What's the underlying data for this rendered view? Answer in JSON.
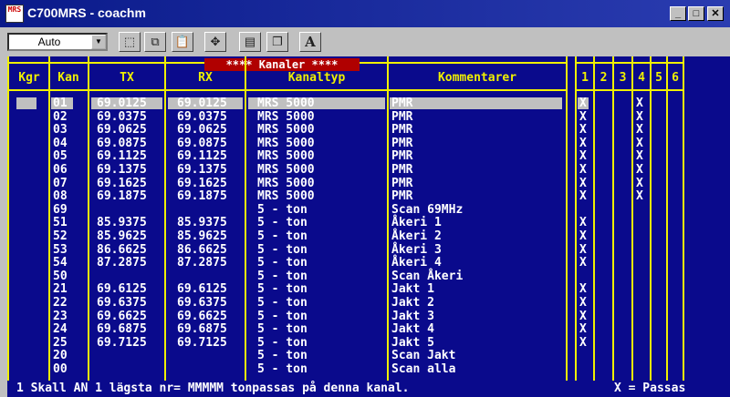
{
  "window": {
    "title": "C700MRS - coachm",
    "icon_text": "MRS",
    "minimize": "_",
    "maximize": "□",
    "close": "✕"
  },
  "toolbar": {
    "zoom_value": "Auto",
    "combo_arrow": "▼",
    "buttons": [
      {
        "name": "select-icon",
        "glyph": "⬚"
      },
      {
        "name": "copy-icon",
        "glyph": "⧉"
      },
      {
        "name": "paste-icon",
        "glyph": "📋"
      },
      {
        "name": "fullscreen-icon",
        "glyph": "✥"
      },
      {
        "name": "properties-icon",
        "glyph": "▤"
      },
      {
        "name": "background-icon",
        "glyph": "❐"
      },
      {
        "name": "font-icon",
        "glyph": "A"
      }
    ]
  },
  "banner": "**** Kanaler ****",
  "headers": {
    "kgr": "Kgr",
    "kan": "Kan",
    "tx": "TX",
    "rx": "RX",
    "kanaltyp": "Kanaltyp",
    "kommentarer": "Kommentarer",
    "c1": "1",
    "c2": "2",
    "c3": "3",
    "c4": "4",
    "c5": "5",
    "c6": "6"
  },
  "rows": [
    {
      "kan": "01",
      "tx": "69.0125",
      "rx": "69.0125",
      "typ": "MRS 5000",
      "kom": "PMR",
      "c1": "X",
      "c4": "X"
    },
    {
      "kan": "02",
      "tx": "69.0375",
      "rx": "69.0375",
      "typ": "MRS 5000",
      "kom": "PMR",
      "c1": "X",
      "c4": "X"
    },
    {
      "kan": "03",
      "tx": "69.0625",
      "rx": "69.0625",
      "typ": "MRS 5000",
      "kom": "PMR",
      "c1": "X",
      "c4": "X"
    },
    {
      "kan": "04",
      "tx": "69.0875",
      "rx": "69.0875",
      "typ": "MRS 5000",
      "kom": "PMR",
      "c1": "X",
      "c4": "X"
    },
    {
      "kan": "05",
      "tx": "69.1125",
      "rx": "69.1125",
      "typ": "MRS 5000",
      "kom": "PMR",
      "c1": "X",
      "c4": "X"
    },
    {
      "kan": "06",
      "tx": "69.1375",
      "rx": "69.1375",
      "typ": "MRS 5000",
      "kom": "PMR",
      "c1": "X",
      "c4": "X"
    },
    {
      "kan": "07",
      "tx": "69.1625",
      "rx": "69.1625",
      "typ": "MRS 5000",
      "kom": "PMR",
      "c1": "X",
      "c4": "X"
    },
    {
      "kan": "08",
      "tx": "69.1875",
      "rx": "69.1875",
      "typ": "MRS 5000",
      "kom": "PMR",
      "c1": "X",
      "c4": "X"
    },
    {
      "kan": "69",
      "tx": "",
      "rx": "",
      "typ": "5 - ton",
      "kom": "Scan 69MHz",
      "c1": "",
      "c4": ""
    },
    {
      "kan": "51",
      "tx": "85.9375",
      "rx": "85.9375",
      "typ": "5 - ton",
      "kom": "Åkeri 1",
      "c1": "X",
      "c4": ""
    },
    {
      "kan": "52",
      "tx": "85.9625",
      "rx": "85.9625",
      "typ": "5 - ton",
      "kom": "Åkeri 2",
      "c1": "X",
      "c4": ""
    },
    {
      "kan": "53",
      "tx": "86.6625",
      "rx": "86.6625",
      "typ": "5 - ton",
      "kom": "Åkeri 3",
      "c1": "X",
      "c4": ""
    },
    {
      "kan": "54",
      "tx": "87.2875",
      "rx": "87.2875",
      "typ": "5 - ton",
      "kom": "Åkeri 4",
      "c1": "X",
      "c4": ""
    },
    {
      "kan": "50",
      "tx": "",
      "rx": "",
      "typ": "5 - ton",
      "kom": "Scan Åkeri",
      "c1": "",
      "c4": ""
    },
    {
      "kan": "21",
      "tx": "69.6125",
      "rx": "69.6125",
      "typ": "5 - ton",
      "kom": "Jakt 1",
      "c1": "X",
      "c4": ""
    },
    {
      "kan": "22",
      "tx": "69.6375",
      "rx": "69.6375",
      "typ": "5 - ton",
      "kom": "Jakt 2",
      "c1": "X",
      "c4": ""
    },
    {
      "kan": "23",
      "tx": "69.6625",
      "rx": "69.6625",
      "typ": "5 - ton",
      "kom": "Jakt 3",
      "c1": "X",
      "c4": ""
    },
    {
      "kan": "24",
      "tx": "69.6875",
      "rx": "69.6875",
      "typ": "5 - ton",
      "kom": "Jakt 4",
      "c1": "X",
      "c4": ""
    },
    {
      "kan": "25",
      "tx": "69.7125",
      "rx": "69.7125",
      "typ": "5 - ton",
      "kom": "Jakt 5",
      "c1": "X",
      "c4": ""
    },
    {
      "kan": "20",
      "tx": "",
      "rx": "",
      "typ": "5 - ton",
      "kom": "Scan Jakt",
      "c1": "",
      "c4": ""
    },
    {
      "kan": "00",
      "tx": "",
      "rx": "",
      "typ": "5 - ton",
      "kom": "Scan alla",
      "c1": "",
      "c4": ""
    }
  ],
  "status": {
    "left": "1 Skall AN 1 lägsta nr= MMMMM  tonpassas på denna kanal.",
    "right": "X = Passas"
  },
  "colors": {
    "background": "#0a0a8c",
    "grid": "#f0f000",
    "text": "#ffffff",
    "banner": "#b00000",
    "selection": "#c0c0c0"
  }
}
